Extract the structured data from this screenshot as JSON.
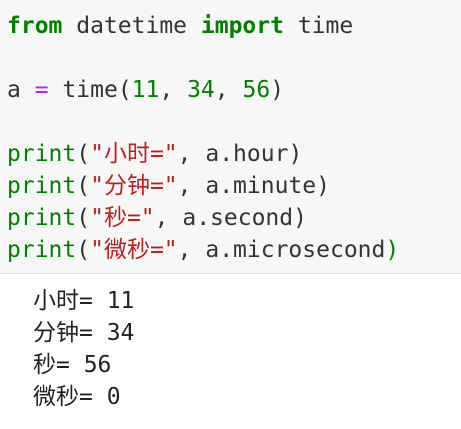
{
  "code": {
    "line1": {
      "kw_from": "from",
      "module": " datetime ",
      "kw_import": "import",
      "name": " time"
    },
    "line3": {
      "var": "a ",
      "eq": "=",
      "call": " time",
      "lp": "(",
      "n1": "11",
      "sep1": ", ",
      "n2": "34",
      "sep2": ", ",
      "n3": "56",
      "rp": ")"
    },
    "line5": {
      "fn": "print",
      "lp": "(",
      "str": "\"小时=\"",
      "rest": ", a.hour",
      "rp": ")"
    },
    "line6": {
      "fn": "print",
      "lp": "(",
      "str": "\"分钟=\"",
      "rest": ", a.minute",
      "rp": ")"
    },
    "line7": {
      "fn": "print",
      "lp": "(",
      "str": "\"秒=\"",
      "rest": ", a.second",
      "rp": ")"
    },
    "line8": {
      "fn": "print",
      "lp": "(",
      "str": "\"微秒=\"",
      "rest": ", a.microsecond",
      "rp": ")"
    }
  },
  "output": [
    "小时= 11",
    "分钟= 34",
    "秒= 56",
    "微秒= 0"
  ],
  "colors": {
    "keyword": "#008000",
    "operator": "#aa22ff",
    "number": "#008000",
    "string": "#ba2121",
    "code_background": "#f7f7f7"
  }
}
